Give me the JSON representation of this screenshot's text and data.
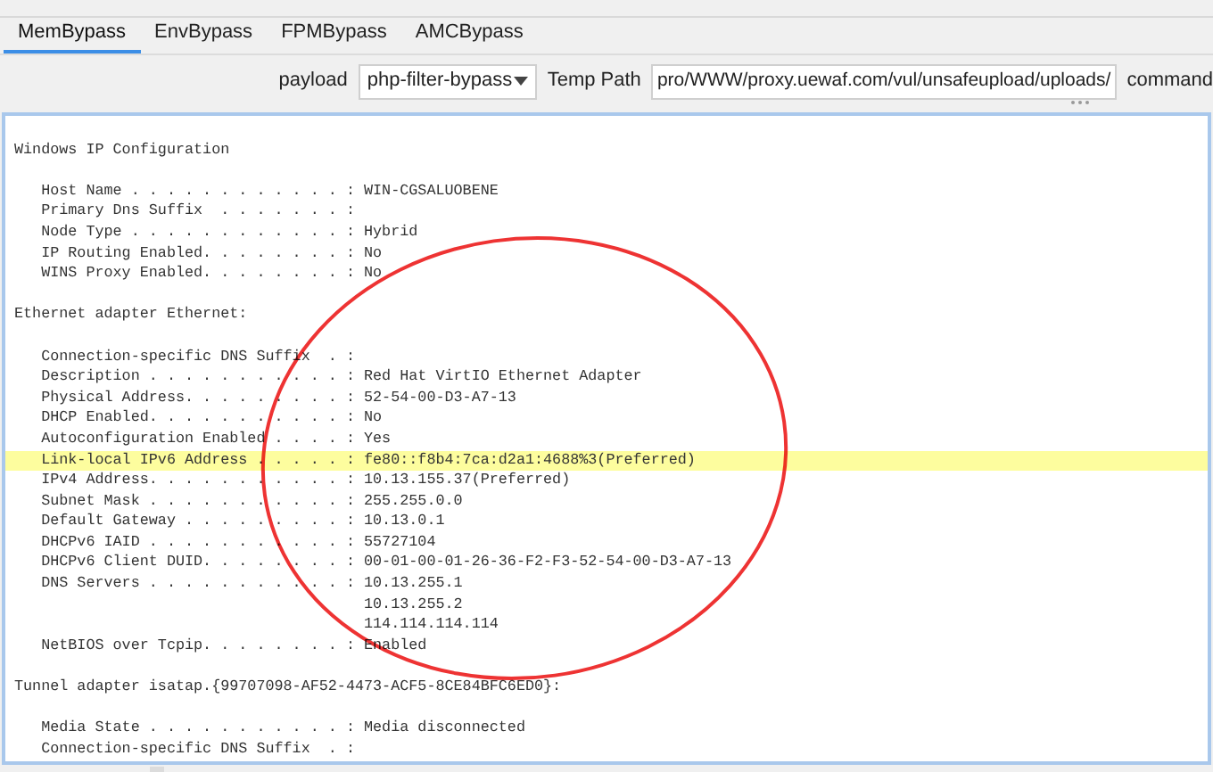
{
  "tabs": [
    {
      "label": "MemBypass",
      "selected": true
    },
    {
      "label": "EnvBypass",
      "selected": false
    },
    {
      "label": "FPMBypass",
      "selected": false
    },
    {
      "label": "AMCBypass",
      "selected": false
    }
  ],
  "toolbar": {
    "payload_label": "payload",
    "payload_value": "php-filter-bypass",
    "temp_path_label": "Temp Path",
    "temp_path_value": "pro/WWW/proxy.uewaf.com/vul/unsafeupload/uploads/",
    "command_label": "command"
  },
  "output": {
    "lines": [
      {
        "kind": "blank"
      },
      {
        "kind": "text",
        "text": "Windows IP Configuration",
        "highlighted": false
      },
      {
        "kind": "blank"
      },
      {
        "kind": "text",
        "text": "   Host Name . . . . . . . . . . . . : WIN-CGSALUOBENE",
        "highlighted": false
      },
      {
        "kind": "text",
        "text": "   Primary Dns Suffix  . . . . . . . :",
        "highlighted": false
      },
      {
        "kind": "text",
        "text": "   Node Type . . . . . . . . . . . . : Hybrid",
        "highlighted": false
      },
      {
        "kind": "text",
        "text": "   IP Routing Enabled. . . . . . . . : No",
        "highlighted": false
      },
      {
        "kind": "text",
        "text": "   WINS Proxy Enabled. . . . . . . . : No",
        "highlighted": false
      },
      {
        "kind": "blank"
      },
      {
        "kind": "text",
        "text": "Ethernet adapter Ethernet:",
        "highlighted": false
      },
      {
        "kind": "blank"
      },
      {
        "kind": "text",
        "text": "   Connection-specific DNS Suffix  . :",
        "highlighted": false
      },
      {
        "kind": "text",
        "text": "   Description . . . . . . . . . . . : Red Hat VirtIO Ethernet Adapter",
        "highlighted": false
      },
      {
        "kind": "text",
        "text": "   Physical Address. . . . . . . . . : 52-54-00-D3-A7-13",
        "highlighted": false
      },
      {
        "kind": "text",
        "text": "   DHCP Enabled. . . . . . . . . . . : No",
        "highlighted": false
      },
      {
        "kind": "text",
        "text": "   Autoconfiguration Enabled . . . . : Yes",
        "highlighted": false
      },
      {
        "kind": "text",
        "text": "   Link-local IPv6 Address . . . . . : fe80::f8b4:7ca:d2a1:4688%3(Preferred)",
        "highlighted": true
      },
      {
        "kind": "text",
        "text": "   IPv4 Address. . . . . . . . . . . : 10.13.155.37(Preferred)",
        "highlighted": false
      },
      {
        "kind": "text",
        "text": "   Subnet Mask . . . . . . . . . . . : 255.255.0.0",
        "highlighted": false
      },
      {
        "kind": "text",
        "text": "   Default Gateway . . . . . . . . . : 10.13.0.1",
        "highlighted": false
      },
      {
        "kind": "text",
        "text": "   DHCPv6 IAID . . . . . . . . . . . : 55727104",
        "highlighted": false
      },
      {
        "kind": "text",
        "text": "   DHCPv6 Client DUID. . . . . . . . : 00-01-00-01-26-36-F2-F3-52-54-00-D3-A7-13",
        "highlighted": false
      },
      {
        "kind": "text",
        "text": "   DNS Servers . . . . . . . . . . . : 10.13.255.1",
        "highlighted": false
      },
      {
        "kind": "text",
        "text": "                                       10.13.255.2",
        "highlighted": false
      },
      {
        "kind": "text",
        "text": "                                       114.114.114.114",
        "highlighted": false
      },
      {
        "kind": "text",
        "text": "   NetBIOS over Tcpip. . . . . . . . : Enabled",
        "highlighted": false
      },
      {
        "kind": "blank"
      },
      {
        "kind": "text",
        "text": "Tunnel adapter isatap.{99707098-AF52-4473-ACF5-8CE84BFC6ED0}:",
        "highlighted": false
      },
      {
        "kind": "blank"
      },
      {
        "kind": "text",
        "text": "   Media State . . . . . . . . . . . : Media disconnected",
        "highlighted": false
      },
      {
        "kind": "text",
        "text": "   Connection-specific DNS Suffix  . :",
        "highlighted": false
      }
    ]
  }
}
